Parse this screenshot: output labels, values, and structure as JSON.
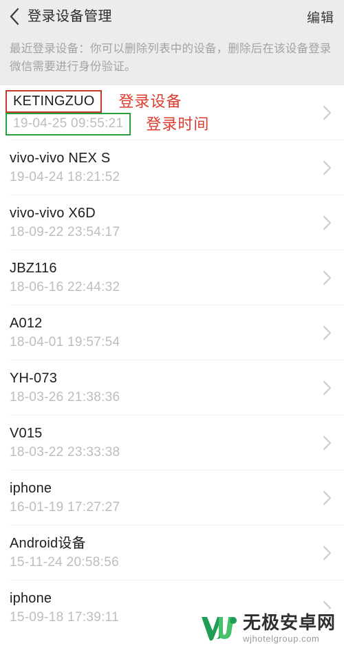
{
  "header": {
    "back_icon": "chevron-left-icon",
    "title": "登录设备管理",
    "action_label": "编辑"
  },
  "description": {
    "text": "最近登录设备：你可以删除列表中的设备，删除后在该设备登录微信需要进行身份验证。"
  },
  "annotations": {
    "device_label": "登录设备",
    "time_label": "登录时间",
    "device_box_color": "#c0392b",
    "time_box_color": "#27a03c",
    "label_color": "#e03a2f"
  },
  "devices": [
    {
      "name": "KETINGZUO",
      "time": "19-04-25 09:55:21",
      "chevron": "chevron-right-icon"
    },
    {
      "name": "vivo-vivo NEX S",
      "time": "19-04-24 18:21:52",
      "chevron": "chevron-right-icon"
    },
    {
      "name": "vivo-vivo X6D",
      "time": "18-09-22 23:54:17",
      "chevron": "chevron-right-icon"
    },
    {
      "name": "JBZ116",
      "time": "18-06-16 22:44:32",
      "chevron": "chevron-right-icon"
    },
    {
      "name": "A012",
      "time": "18-04-01 19:57:54",
      "chevron": "chevron-right-icon"
    },
    {
      "name": "YH-073",
      "time": "18-03-26 21:38:36",
      "chevron": "chevron-right-icon"
    },
    {
      "name": "V015",
      "time": "18-03-22 23:33:38",
      "chevron": "chevron-right-icon"
    },
    {
      "name": "iphone",
      "time": "16-01-19 17:27:27",
      "chevron": "chevron-right-icon"
    },
    {
      "name": "Android设备",
      "time": "15-11-24 20:58:56",
      "chevron": "chevron-right-icon"
    },
    {
      "name": "iphone",
      "time": "15-09-18 17:39:11",
      "chevron": "chevron-right-icon"
    }
  ],
  "watermark": {
    "title": "无极安卓网",
    "url": "wjhotelgroup.com",
    "logo_color_dark": "#1f9d55",
    "logo_color_light": "#47c26b"
  },
  "colors": {
    "nav_background": "#ececec",
    "page_background": "#ffffff",
    "device_name": "#1d1d1d",
    "device_time": "#bdbdbd",
    "description_text": "#a3a3a3",
    "separator": "#efefef"
  }
}
